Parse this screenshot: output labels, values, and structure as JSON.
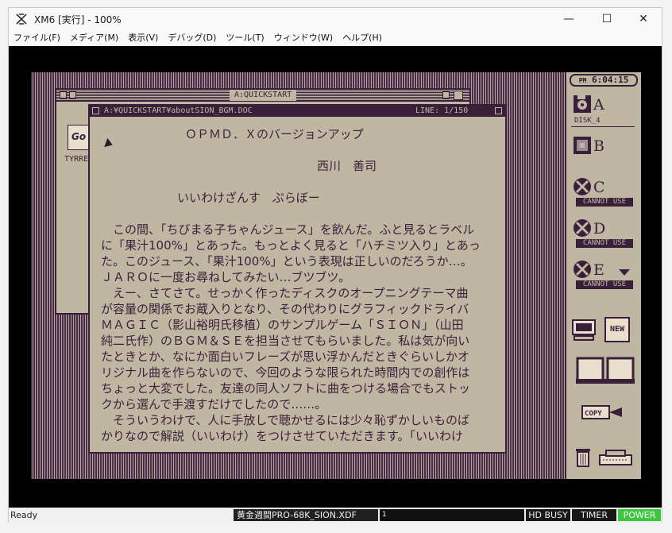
{
  "window": {
    "title": "XM6 [実行] - 100%",
    "controls": {
      "minimize": "—",
      "maximize": "☐",
      "close": "✕"
    }
  },
  "menu": [
    "ファイル(F)",
    "メディア(M)",
    "表示(V)",
    "デバッグ(D)",
    "ツール(T)",
    "ウィンドウ(W)",
    "ヘルプ(H)"
  ],
  "desktop": {
    "clock": {
      "ampm": "PM",
      "time": "6:04:15"
    },
    "drives": [
      {
        "letter": "A",
        "sub": "DISK_4"
      },
      {
        "letter": "B",
        "sub": ""
      },
      {
        "letter": "C",
        "sub": "CANNOT USE"
      },
      {
        "letter": "D",
        "sub": "CANNOT USE"
      },
      {
        "letter": "E",
        "sub": "CANNOT USE"
      }
    ],
    "bg_window": {
      "title": "A:QUICKSTART",
      "icon_label": "TYRRE"
    },
    "doc_window": {
      "path": "A:¥QUICKSTART¥aboutSION_BGM.DOC",
      "line_info": "LINE:    1/150",
      "title_line": "ＯＰＭＤ．Ｘのバージョンアップ",
      "author": "西川　善司",
      "subtitle": "いいわけざんす　ぷらぼー",
      "paragraph": [
        "　この間、「ちびまる子ちゃんジュース」を飲んだ。ふと見るとラベル",
        "に「果汁100%」とあった。もっとよく見ると「ハチミツ入り」とあっ",
        "た。このジュース、「果汁100%」という表現は正しいのだろうか…。",
        "ＪＡＲＯに一度お尋ねしてみたい…ブツブツ。",
        "　えー、さてさて。せっかく作ったディスクのオープニングテーマ曲",
        "が容量の関係でお蔵入りとなり、その代わりにグラフィックドライバ",
        "ＭＡＧＩＣ（影山裕明氏移植）のサンプルゲーム「ＳＩＯＮ」（山田",
        "純二氏作）のＢＧＭ＆ＳＥを担当させてもらいました。私は気が向い",
        "たときとか、なにか面白いフレーズが思い浮かんだときぐらいしかオ",
        "リジナル曲を作らないので、今回のような限られた時間内での創作は",
        "ちょっと大変でした。友達の同人ソフトに曲をつける場合でもストッ",
        "クから選んで手渡すだけでしたので……。",
        "　そういうわけで、人に手放しで聴かせるには少々恥ずかしいものば",
        "かりなので解説（いいわけ）をつけさせていただきます。「いいわけ"
      ]
    },
    "icons": [
      "new-icon",
      "computer-icon",
      "drawers-icon",
      "copy-icon",
      "trash-icon",
      "printer-icon"
    ],
    "new_label": "NEW",
    "copy_label": "COPY"
  },
  "status": {
    "ready": "Ready",
    "disk": "黄金週間PRO-68K_SION.XDF",
    "field2": "1",
    "hd_busy": "HD BUSY",
    "timer": "TIMER",
    "power": "POWER"
  },
  "colors": {
    "desk_dark": "#3a1f3a",
    "desk_light": "#c0b7a3",
    "power_green": "#3cc83c"
  }
}
